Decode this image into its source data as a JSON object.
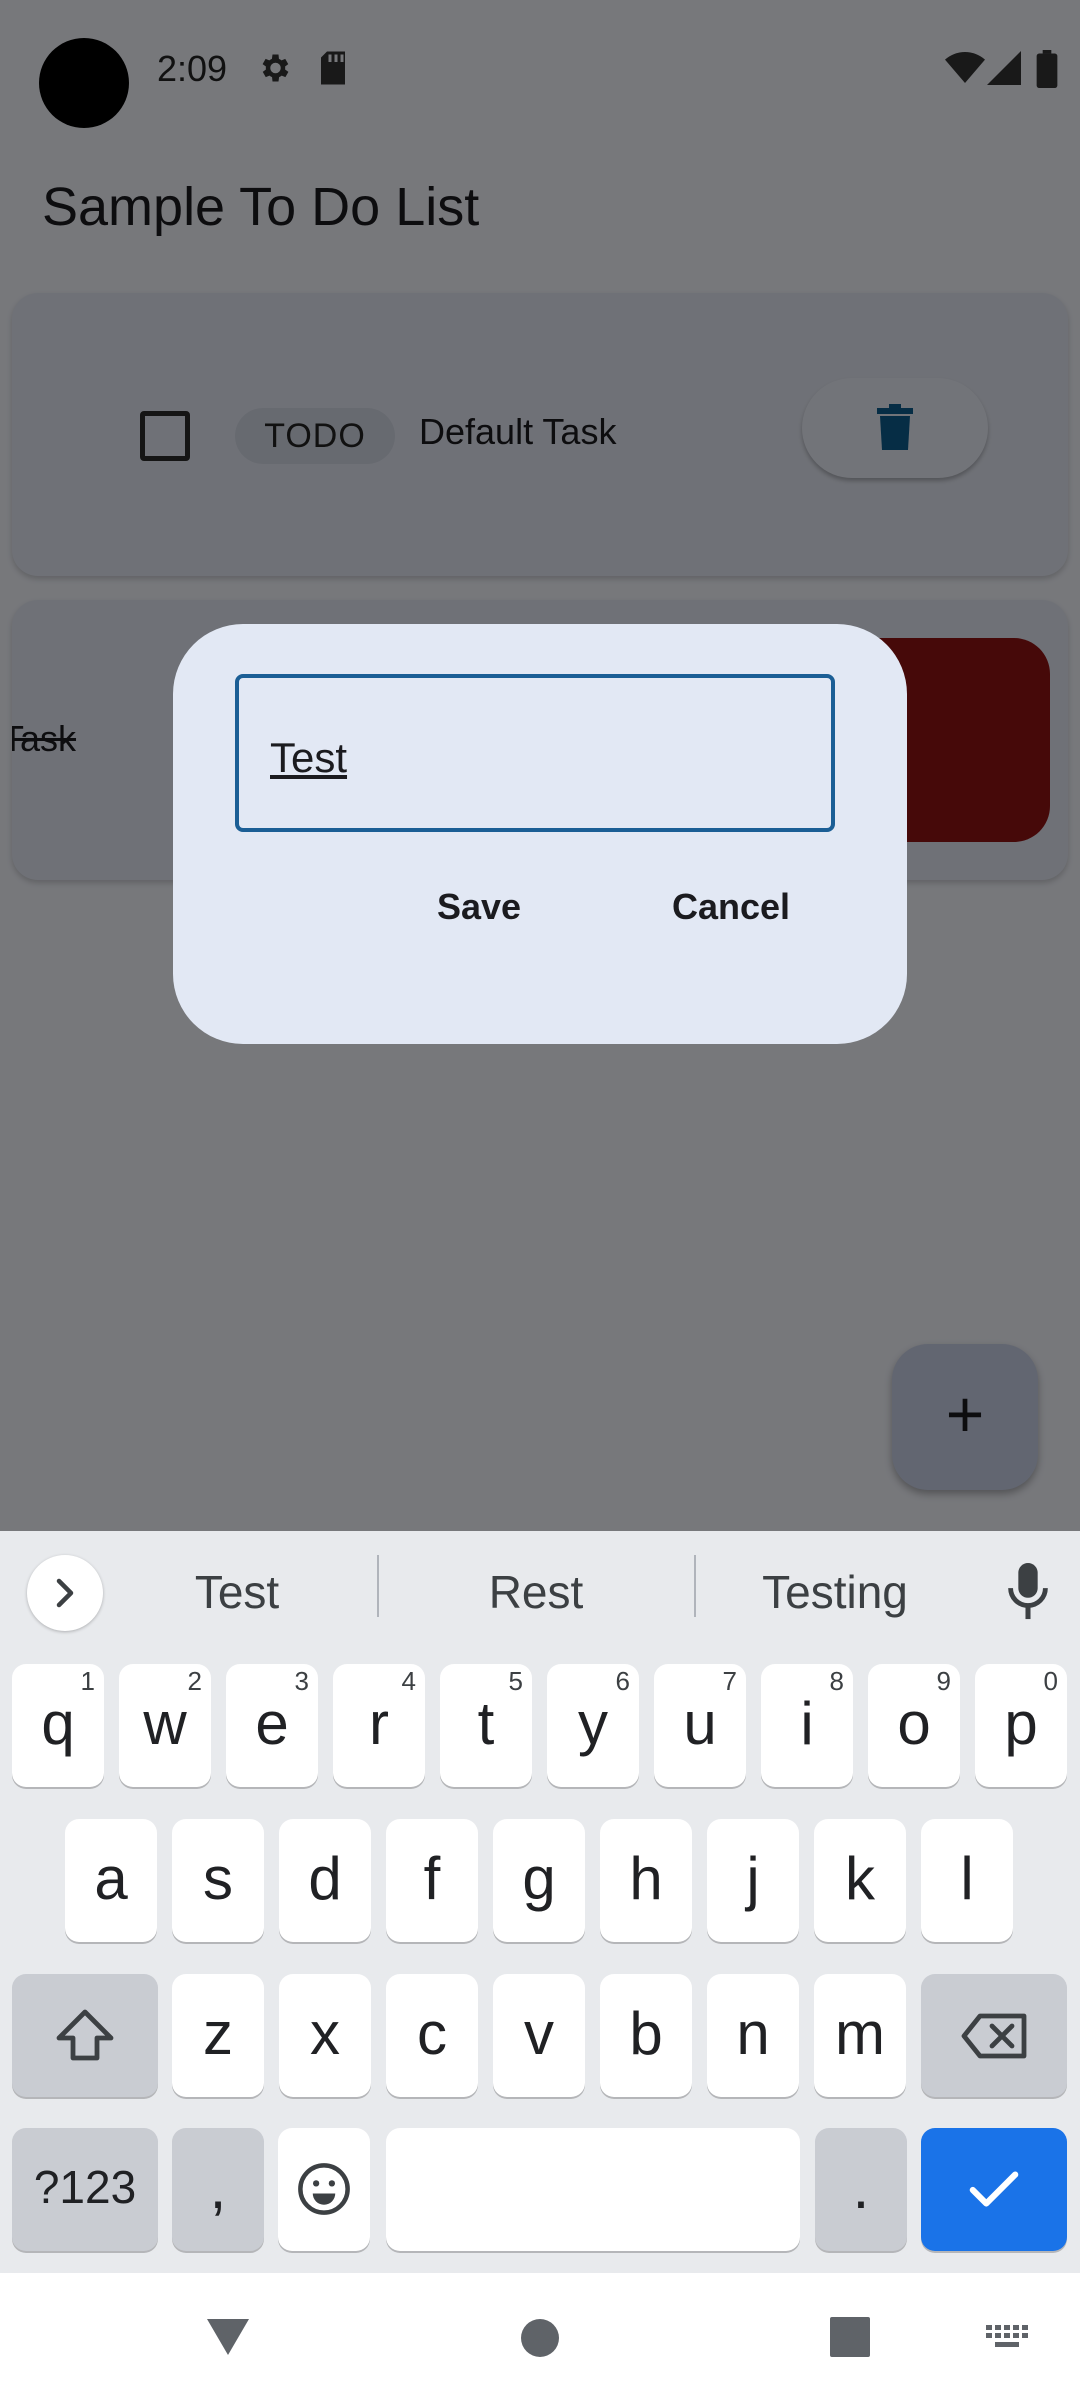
{
  "status_bar": {
    "time": "2:09",
    "icons": [
      "gear-icon",
      "sd-card-icon",
      "wifi-icon",
      "signal-icon",
      "battery-icon"
    ]
  },
  "app": {
    "title": "Sample To Do List"
  },
  "tasks": [
    {
      "status": "TODO",
      "text": "Default Task",
      "done": false
    },
    {
      "text": "Task",
      "done": true
    }
  ],
  "fab": {
    "label": "+"
  },
  "dialog": {
    "input_value": "Test",
    "save_label": "Save",
    "cancel_label": "Cancel"
  },
  "keyboard": {
    "suggestions": [
      "Test",
      "Rest",
      "Testing"
    ],
    "row1": [
      {
        "key": "q",
        "alt": "1"
      },
      {
        "key": "w",
        "alt": "2"
      },
      {
        "key": "e",
        "alt": "3"
      },
      {
        "key": "r",
        "alt": "4"
      },
      {
        "key": "t",
        "alt": "5"
      },
      {
        "key": "y",
        "alt": "6"
      },
      {
        "key": "u",
        "alt": "7"
      },
      {
        "key": "i",
        "alt": "8"
      },
      {
        "key": "o",
        "alt": "9"
      },
      {
        "key": "p",
        "alt": "0"
      }
    ],
    "row2": [
      "a",
      "s",
      "d",
      "f",
      "g",
      "h",
      "j",
      "k",
      "l"
    ],
    "row3": [
      "z",
      "x",
      "c",
      "v",
      "b",
      "n",
      "m"
    ],
    "symbols_label": "?123",
    "comma": ",",
    "period": "."
  },
  "colors": {
    "accent": "#1a73e8",
    "delete_icon": "#0d5a8a",
    "danger": "#8c1212",
    "input_border": "#1b5e95"
  }
}
